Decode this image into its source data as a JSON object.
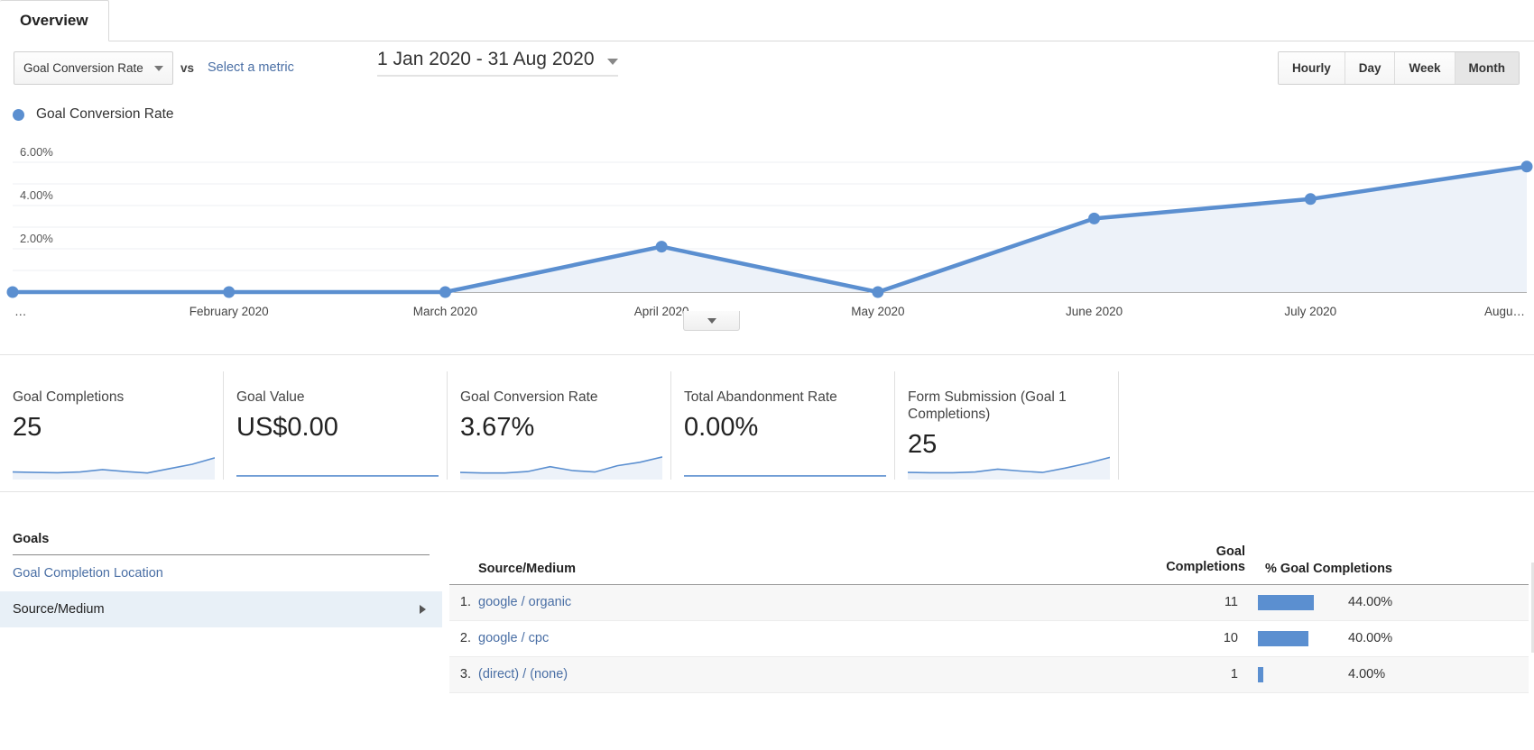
{
  "tab": {
    "label": "Overview"
  },
  "toolbar": {
    "metric_select_value": "Goal Conversion Rate",
    "vs_label": "vs",
    "select_metric_link": "Select a metric",
    "date_range": "1 Jan 2020 - 31 Aug 2020",
    "granularity": [
      {
        "label": "Hourly",
        "active": false
      },
      {
        "label": "Day",
        "active": false
      },
      {
        "label": "Week",
        "active": false
      },
      {
        "label": "Month",
        "active": true
      }
    ]
  },
  "legend": {
    "label": "Goal Conversion Rate",
    "color": "#5b8fd0"
  },
  "chart_data": {
    "type": "line",
    "title": "Goal Conversion Rate",
    "xlabel": "",
    "ylabel": "",
    "categories": [
      "…",
      "February 2020",
      "March 2020",
      "April 2020",
      "May 2020",
      "June 2020",
      "July 2020",
      "Augu…"
    ],
    "x_tick_labels": [
      "…",
      "February 2020",
      "March 2020",
      "April 2020",
      "May 2020",
      "June 2020",
      "July 2020",
      "Augu…"
    ],
    "y_tick_labels": [
      "6.00%",
      "4.00%",
      "2.00%"
    ],
    "y_ticks": [
      6.0,
      4.0,
      2.0
    ],
    "ylim": [
      0,
      7.0
    ],
    "grid": true,
    "legend_position": "top-left",
    "series": [
      {
        "name": "Goal Conversion Rate",
        "color": "#5b8fd0",
        "fill": "#edf2f9",
        "values": [
          0.0,
          0.0,
          0.0,
          2.1,
          0.0,
          3.4,
          4.3,
          5.8
        ]
      }
    ]
  },
  "chart_collapse": {
    "icon": "chevron-down-icon"
  },
  "cards": [
    {
      "title": "Goal Completions",
      "value": "25",
      "spark": [
        0.2,
        0.18,
        0.17,
        0.2,
        0.3,
        0.22,
        0.16,
        0.34,
        0.52,
        0.78
      ],
      "filled": true
    },
    {
      "title": "Goal Value",
      "value": "US$0.00",
      "spark": [
        0.04,
        0.04,
        0.04,
        0.04,
        0.04,
        0.04,
        0.04,
        0.04,
        0.04,
        0.04
      ],
      "filled": false
    },
    {
      "title": "Goal Conversion Rate",
      "value": "3.67%",
      "spark": [
        0.18,
        0.16,
        0.16,
        0.22,
        0.42,
        0.26,
        0.2,
        0.46,
        0.6,
        0.82
      ],
      "filled": true
    },
    {
      "title": "Total Abandonment Rate",
      "value": "0.00%",
      "spark": [
        0.04,
        0.04,
        0.04,
        0.04,
        0.04,
        0.04,
        0.04,
        0.04,
        0.04,
        0.04
      ],
      "filled": false
    },
    {
      "title": "Form Submission (Goal 1\nCompletions)",
      "value": "25",
      "spark": [
        0.18,
        0.17,
        0.17,
        0.2,
        0.32,
        0.24,
        0.18,
        0.36,
        0.56,
        0.8
      ],
      "filled": true
    }
  ],
  "goals_panel": {
    "heading": "Goals",
    "items": [
      {
        "label": "Goal Completion Location",
        "selected": false,
        "has_arrow": false
      },
      {
        "label": "Source/Medium",
        "selected": true,
        "has_arrow": true
      }
    ]
  },
  "table": {
    "columns": {
      "source": "Source/Medium",
      "goal_completions": "Goal\nCompletions",
      "pct_goal_completions": "% Goal Completions"
    },
    "rows": [
      {
        "index": "1.",
        "source": "google / organic",
        "goal_completions": "11",
        "pct_text": "44.00%",
        "pct_value": 44.0
      },
      {
        "index": "2.",
        "source": "google / cpc",
        "goal_completions": "10",
        "pct_text": "40.00%",
        "pct_value": 40.0
      },
      {
        "index": "3.",
        "source": "(direct) / (none)",
        "goal_completions": "1",
        "pct_text": "4.00%",
        "pct_value": 4.0
      }
    ]
  },
  "colors": {
    "accent": "#5b8fd0",
    "link": "#4a6fa5",
    "selected_row_bg": "#e8f0f7",
    "area_fill": "#edf2f9"
  }
}
